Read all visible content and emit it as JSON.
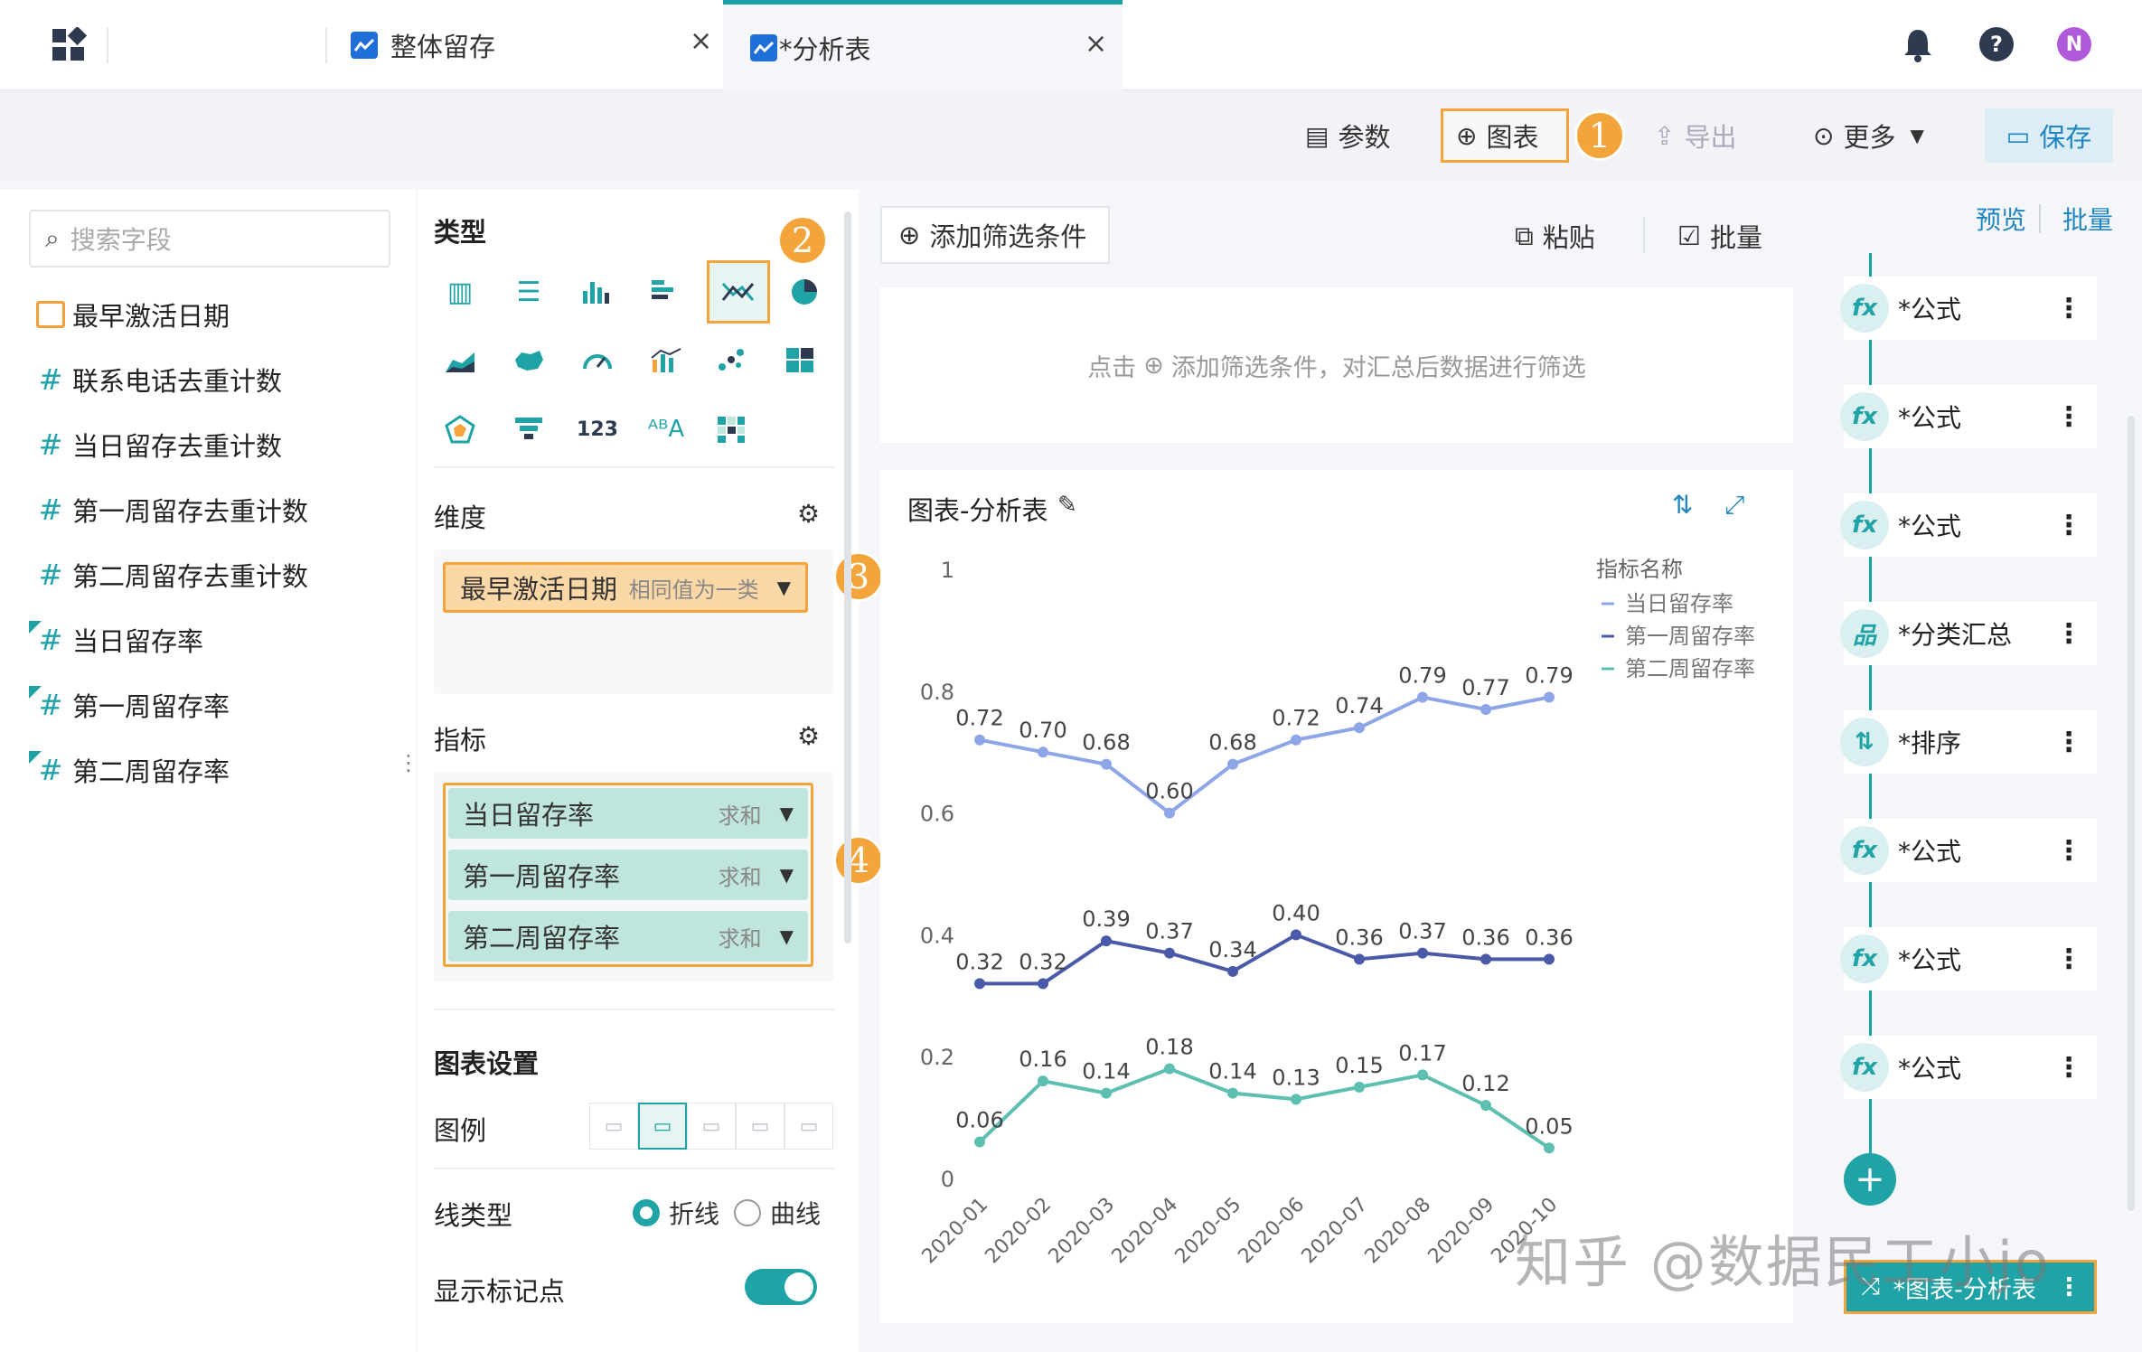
{
  "tabs": [
    {
      "label": "整体留存",
      "close": "×"
    },
    {
      "label": "*分析表",
      "close": "×"
    }
  ],
  "header": {
    "avatar": "N",
    "help": "?"
  },
  "toolbar": {
    "params": "参数",
    "chart": "图表",
    "export": "导出",
    "more": "更多",
    "save": "保存"
  },
  "badges": [
    "1",
    "2",
    "3",
    "4"
  ],
  "field_panel": {
    "search_placeholder": "搜索字段",
    "fields": [
      "最早激活日期",
      "联系电话去重计数",
      "当日留存去重计数",
      "第一周留存去重计数",
      "第二周留存去重计数",
      "当日留存率",
      "第一周留存率",
      "第二周留存率"
    ]
  },
  "config": {
    "type_title": "类型",
    "dimension_title": "维度",
    "dimension_pill": {
      "label": "最早激活日期",
      "sub": "相同值为一类"
    },
    "metric_title": "指标",
    "metric_pills": [
      {
        "label": "当日留存率",
        "sub": "求和"
      },
      {
        "label": "第一周留存率",
        "sub": "求和"
      },
      {
        "label": "第二周留存率",
        "sub": "求和"
      }
    ],
    "chart_settings_title": "图表设置",
    "legend_label": "图例",
    "line_type_label": "线类型",
    "line_opt1": "折线",
    "line_opt2": "曲线",
    "show_markers_label": "显示标记点"
  },
  "filter": {
    "add_button": "添加筛选条件",
    "paste": "粘贴",
    "batch": "批量",
    "empty_text1": "点击",
    "empty_text2": "添加筛选条件，对汇总后数据进行筛选"
  },
  "chart_card": {
    "title": "图表-分析表"
  },
  "right_panel": {
    "preview": "预览",
    "batch": "批量",
    "steps": [
      {
        "label": "*公式",
        "icon": "fx"
      },
      {
        "label": "*公式",
        "icon": "fx"
      },
      {
        "label": "*公式",
        "icon": "fx"
      },
      {
        "label": "*分类汇总",
        "icon": "品"
      },
      {
        "label": "*排序",
        "icon": "⇅"
      },
      {
        "label": "*公式",
        "icon": "fx"
      },
      {
        "label": "*公式",
        "icon": "fx"
      },
      {
        "label": "*公式",
        "icon": "fx"
      }
    ],
    "current_step": "*图表-分析表"
  },
  "watermark": "知乎 @数据民工小jo",
  "chart_data": {
    "type": "line",
    "title": "",
    "legend_title": "指标名称",
    "categories": [
      "2020-01",
      "2020-02",
      "2020-03",
      "2020-04",
      "2020-05",
      "2020-06",
      "2020-07",
      "2020-08",
      "2020-09",
      "2020-10"
    ],
    "ylim": [
      0,
      1
    ],
    "yticks": [
      "0",
      "0.2",
      "0.4",
      "0.6",
      "0.8",
      "1"
    ],
    "series": [
      {
        "name": "当日留存率",
        "color": "#8ea5e8",
        "values": [
          0.72,
          0.7,
          0.68,
          0.6,
          0.68,
          0.72,
          0.74,
          0.79,
          0.77,
          0.79
        ],
        "labels": [
          "0.72",
          "0.70",
          "0.68",
          "0.60",
          "0.68",
          "0.72",
          "0.74",
          "0.79",
          "0.77",
          "0.79"
        ]
      },
      {
        "name": "第一周留存率",
        "color": "#4b5aa8",
        "values": [
          0.32,
          0.32,
          0.39,
          0.37,
          0.34,
          0.4,
          0.36,
          0.37,
          0.36,
          0.36
        ],
        "labels": [
          "0.32",
          "0.32",
          "0.39",
          "0.37",
          "0.34",
          "0.40",
          "0.36",
          "0.37",
          "0.36",
          "0.36"
        ]
      },
      {
        "name": "第二周留存率",
        "color": "#5dbfb0",
        "values": [
          0.06,
          0.16,
          0.14,
          0.18,
          0.14,
          0.13,
          0.15,
          0.17,
          0.12,
          0.05
        ],
        "labels": [
          "0.06",
          "0.16",
          "0.14",
          "0.18",
          "0.14",
          "0.13",
          "0.15",
          "0.17",
          "0.12",
          "0.05"
        ]
      }
    ]
  }
}
